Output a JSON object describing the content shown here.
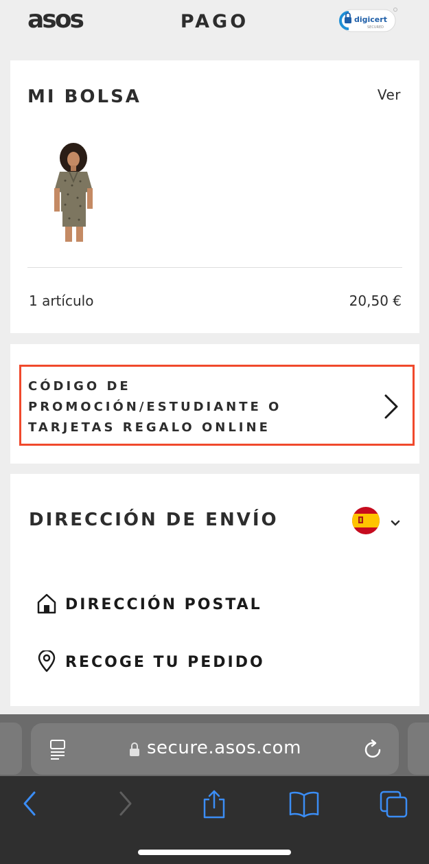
{
  "header": {
    "logo": "asos",
    "title": "PAGO",
    "badge_text": "digicert",
    "badge_sub": "SECURED"
  },
  "bag": {
    "title": "MI BOLSA",
    "view_label": "Ver",
    "item_count": "1 artículo",
    "total": "20,50 €"
  },
  "promo": {
    "label": "CÓDIGO DE PROMOCIÓN/ESTUDIANTE O TARJETAS REGALO ONLINE",
    "highlight_color": "#f0492c"
  },
  "shipping": {
    "title": "DIRECCIÓN DE ENVÍO",
    "country_flag": "spain-flag-icon",
    "options": [
      {
        "label": "DIRECCIÓN POSTAL",
        "icon": "house-icon"
      },
      {
        "label": "RECOGE TU PEDIDO",
        "icon": "location-pin-icon"
      }
    ]
  },
  "browser": {
    "url": "secure.asos.com",
    "accent": "#3b8df5"
  }
}
